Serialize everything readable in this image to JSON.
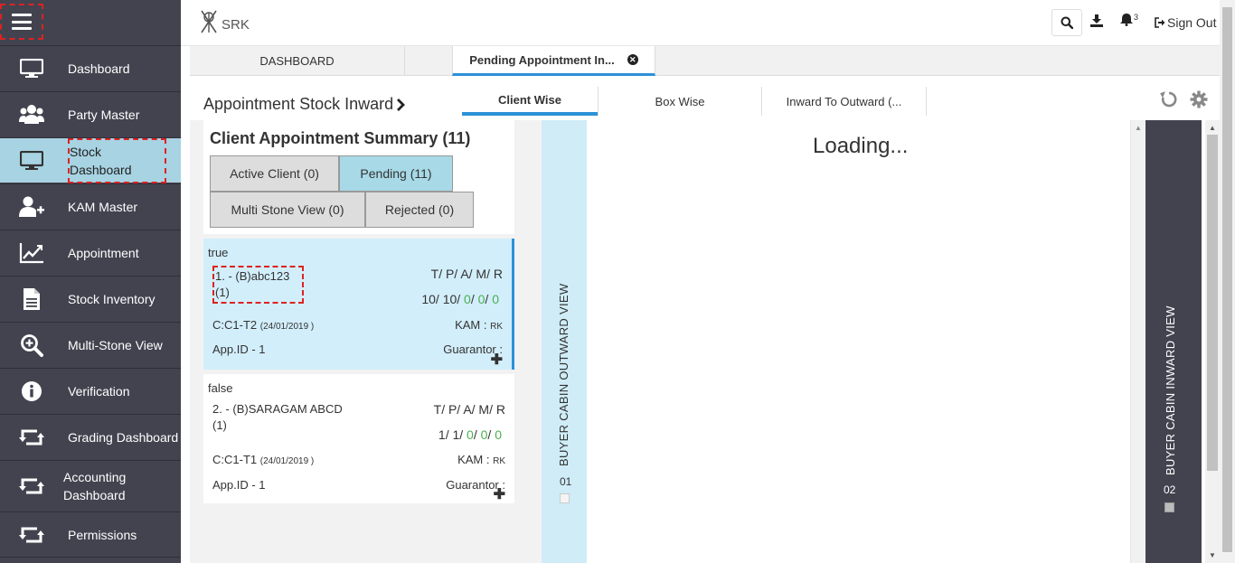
{
  "header": {
    "logo_text": "SRK",
    "notification_count": "3",
    "sign_out": "Sign Out"
  },
  "sidebar": {
    "items": [
      {
        "label": "Dashboard",
        "icon": "monitor-icon"
      },
      {
        "label": "Party Master",
        "icon": "users-icon"
      },
      {
        "label": "Stock Dashboard",
        "icon": "monitor-icon",
        "active": true
      },
      {
        "label": "KAM Master",
        "icon": "user-plus-icon"
      },
      {
        "label": "Appointment",
        "icon": "line-chart-icon"
      },
      {
        "label": "Stock Inventory",
        "icon": "document-icon"
      },
      {
        "label": "Multi-Stone View",
        "icon": "zoom-in-icon"
      },
      {
        "label": "Verification",
        "icon": "info-icon"
      },
      {
        "label": "Grading Dashboard",
        "icon": "retweet-icon"
      },
      {
        "label": "Accounting Dashboard",
        "icon": "retweet-icon"
      },
      {
        "label": "Permissions",
        "icon": "retweet-icon"
      }
    ]
  },
  "tabs": [
    {
      "label": "DASHBOARD"
    },
    {
      "label": "Pending Appointment In..."
    }
  ],
  "page": {
    "title": "Appointment Stock Inward",
    "subtabs": [
      "Client Wise",
      "Box Wise",
      "Inward To Outward (..."
    ]
  },
  "summary": {
    "title": "Client Appointment Summary (11)",
    "filters": [
      "Active Client (0)",
      "Pending (11)",
      "Multi Stone View (0)",
      "Rejected (0)"
    ]
  },
  "cards": [
    {
      "flag": "true",
      "name": "1. - (B)abc123 (1)",
      "tpam": "T/ P/ A/ M/ R",
      "nums": [
        "10",
        "10",
        "0",
        "0",
        "0"
      ],
      "code": "C:C1-T2",
      "date": "(24/01/2019 )",
      "kam_label": "KAM :",
      "kam_value": "RK",
      "app_id": "App.ID - 1",
      "guarantor": "Guarantor :"
    },
    {
      "flag": "false",
      "name": "2. - (B)SARAGAM ABCD (1)",
      "tpam": "T/ P/ A/ M/ R",
      "nums": [
        "1",
        "1",
        "0",
        "0",
        "0"
      ],
      "code": "C:C1-T1",
      "date": "(24/01/2019 )",
      "kam_label": "KAM :",
      "kam_value": "RK",
      "app_id": "App.ID - 1",
      "guarantor": "Guarantor :"
    }
  ],
  "outward": {
    "label": "BUYER CABIN OUTWARD VIEW",
    "number": "01"
  },
  "inward": {
    "label": "BUYER CABIN INWARD VIEW",
    "number": "02"
  },
  "loading": "Loading..."
}
